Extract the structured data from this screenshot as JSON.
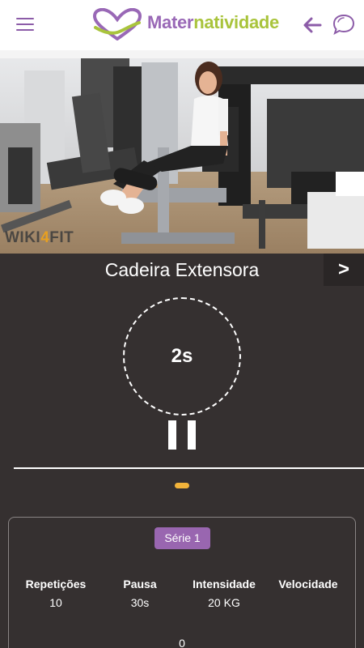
{
  "header": {
    "brand_prefix": "Mater",
    "brand_suffix": "natividade",
    "colors": {
      "purple": "#9968b6",
      "green": "#a9c43c"
    },
    "icons": [
      "menu-icon",
      "heart-logo-icon",
      "back-arrow-icon",
      "chat-bubble-icon"
    ]
  },
  "media": {
    "watermark_prefix": "WIKI",
    "watermark_number": "4",
    "watermark_suffix": "FIT"
  },
  "exercise": {
    "name": "Cadeira Extensora",
    "next_label": ">"
  },
  "timer": {
    "value": "2s",
    "state": "running",
    "pause_icon": "pause-icon"
  },
  "pager": {
    "active_color": "#f2b33a"
  },
  "series": {
    "badge": "Série 1",
    "stats": [
      {
        "label": "Repetições",
        "value": "10"
      },
      {
        "label": "Pausa",
        "value": "30s"
      },
      {
        "label": "Intensidade",
        "value": "20 KG"
      },
      {
        "label": "Velocidade",
        "value": ""
      }
    ],
    "bottom_value": "0"
  }
}
